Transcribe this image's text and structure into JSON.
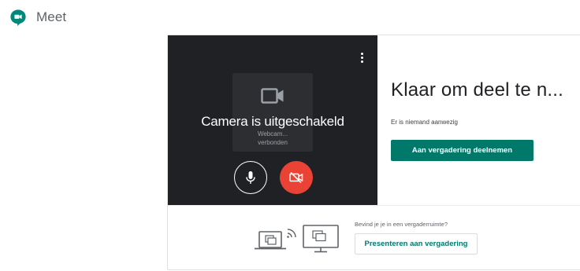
{
  "app": {
    "name": "Meet",
    "brand_color": "#00897b"
  },
  "preview": {
    "camera_off_text": "Camera is uitgeschakeld",
    "webcam_text_line1": "Webcam...",
    "webcam_text_line2": "verbonden",
    "icons": [
      "more-vert-icon",
      "video-camera-icon",
      "microphone-icon",
      "video-off-icon"
    ],
    "cam_off_color": "#ea4335"
  },
  "join": {
    "title": "Klaar om deel te n...",
    "status": "Er is niemand aanwezig",
    "button_label": "Aan vergadering deelnemen",
    "button_color": "#00796b"
  },
  "present": {
    "question": "Bevind je je in een vergaderruimte?",
    "button_label": "Presenteren aan vergadering"
  }
}
